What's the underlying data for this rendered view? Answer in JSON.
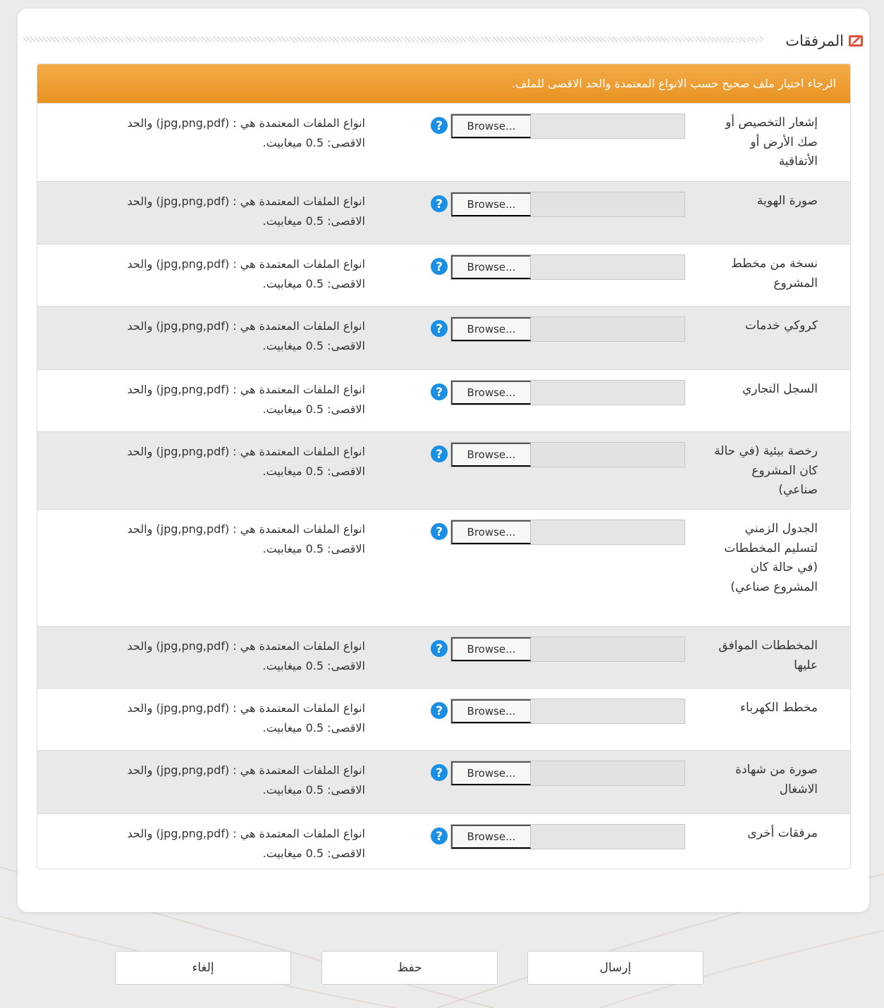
{
  "section": {
    "title": "المرفقات",
    "icon": "edit-attachment-icon"
  },
  "alert": {
    "text": "الرجاء اختيار ملف صحيح حسب الانواع المعتمدة والحد الاقصى للملف."
  },
  "browse_label": "Browse...",
  "hint_line1": "انواع الملفات المعتمدة هي : (jpg,png,pdf) والحد",
  "hint_line2": "الاقصى: 0.5 ميغابيت.",
  "attachments": [
    {
      "label": "إشعار التخصيص أو صك الأرض أو الأتفاقية"
    },
    {
      "label": "صورة الهوية"
    },
    {
      "label": "نسخة من مخطط المشروع"
    },
    {
      "label": "كروكي خدمات"
    },
    {
      "label": "السجل التجاري"
    },
    {
      "label": "رخصة بيئية (في حالة كان المشروع صناعي)"
    },
    {
      "label": "الجدول الزمني لتسليم المخططات (في حالة كان المشروع صناعي)"
    },
    {
      "label": "المخططات الموافق عليها"
    },
    {
      "label": "مخطط الكهرباء"
    },
    {
      "label": "صورة من شهادة الاشغال"
    },
    {
      "label": "مرفقات أخرى"
    }
  ],
  "footer": {
    "submit": "إرسال",
    "save": "حفظ",
    "cancel": "إلغاء"
  },
  "colors": {
    "alert_orange": "#ee9b2b",
    "help_blue": "#1a8fe3",
    "icon_red": "#e0533a"
  }
}
